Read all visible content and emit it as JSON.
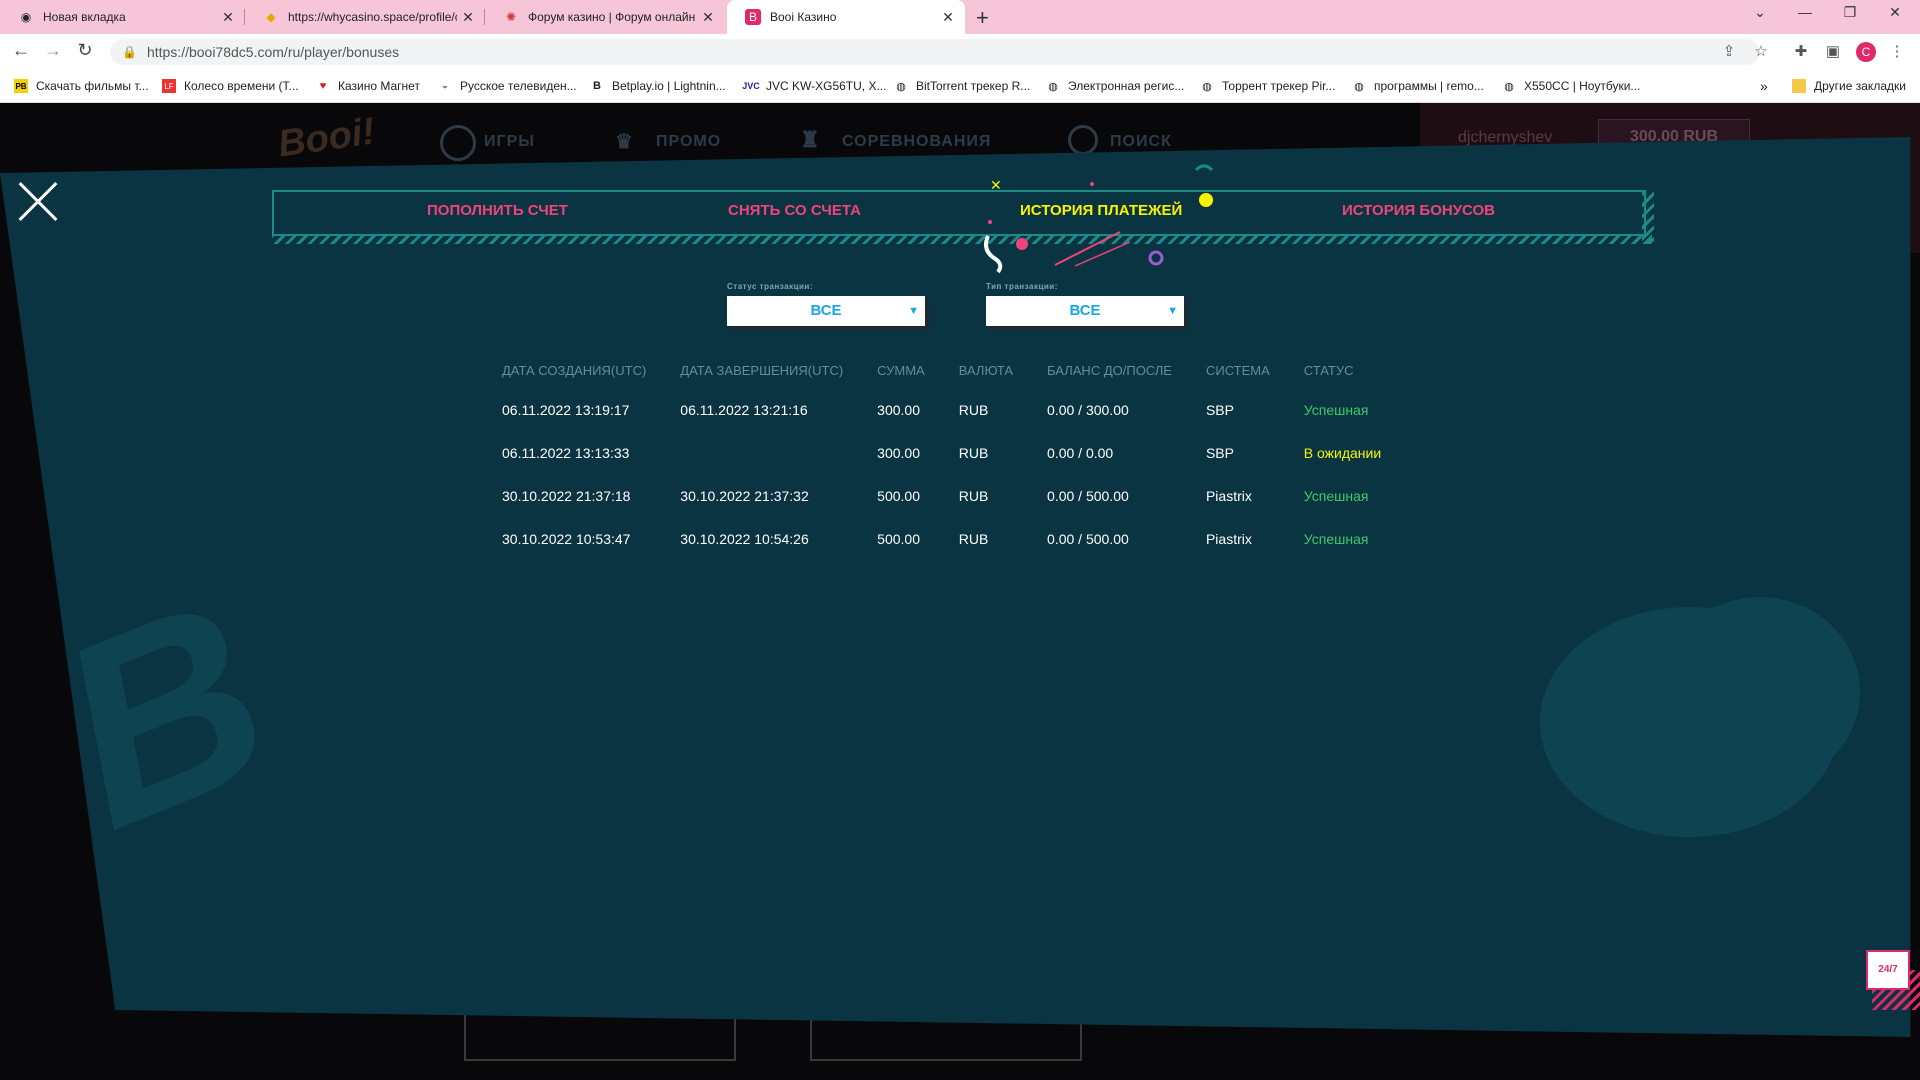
{
  "browser": {
    "tabs": [
      {
        "title": "Новая вкладка",
        "icon": "chrome-icon"
      },
      {
        "title": "https://whycasino.space/profile/c",
        "icon": "diamond-icon"
      },
      {
        "title": "Форум казино | Форум онлайн",
        "icon": "spinner-icon"
      },
      {
        "title": "Booi Казино",
        "icon": "booi-icon"
      }
    ],
    "url": "https://booi78dc5.com/ru/player/bonuses",
    "bookmarks": [
      "Скачать фильмы т...",
      "Колесо времени (T...",
      "Казино Магнет",
      "Русское телевиден...",
      "Betplay.io | Lightnin...",
      "JVC KW-XG56TU, X...",
      "BitTorrent трекер R...",
      "Электронная регис...",
      "Торрент трекер Pir...",
      "программы | remo...",
      "X550CC | Ноутбуки..."
    ],
    "bookmarks_more": "»",
    "other_bookmarks": "Другие закладки"
  },
  "site": {
    "nav": [
      "ИГРЫ",
      "ПРОМО",
      "СОРЕВНОВАНИЯ",
      "ПОИСК"
    ],
    "username": "djchernyshev",
    "balance": "300.00 RUB"
  },
  "modal": {
    "tabs": [
      "ПОПОЛНИТЬ СЧЕТ",
      "СНЯТЬ СО СЧЕТА",
      "ИСТОРИЯ ПЛАТЕЖЕЙ",
      "ИСТОРИЯ БОНУСОВ"
    ],
    "active_tab": "ИСТОРИЯ ПЛАТЕЖЕЙ",
    "filters": {
      "status_label": "Статус транзакции:",
      "status_value": "ВСЕ",
      "type_label": "Тип транзакции:",
      "type_value": "ВСЕ"
    },
    "table": {
      "headers": [
        "ДАТА СОЗДАНИЯ(UTC)",
        "ДАТА ЗАВЕРШЕНИЯ(UTC)",
        "СУММА",
        "ВАЛЮТА",
        "БАЛАНС ДО/ПОСЛЕ",
        "СИСТЕМА",
        "СТАТУС"
      ],
      "rows": [
        [
          "06.11.2022 13:19:17",
          "06.11.2022 13:21:16",
          "300.00",
          "RUB",
          "0.00 / 300.00",
          "SBP",
          "Успешная"
        ],
        [
          "06.11.2022 13:13:33",
          "",
          "300.00",
          "RUB",
          "0.00 / 0.00",
          "SBP",
          "В ожидании"
        ],
        [
          "30.10.2022 21:37:18",
          "30.10.2022 21:37:32",
          "500.00",
          "RUB",
          "0.00 / 500.00",
          "Piastrix",
          "Успешная"
        ],
        [
          "30.10.2022 10:53:47",
          "30.10.2022 10:54:26",
          "500.00",
          "RUB",
          "0.00 / 500.00",
          "Piastrix",
          "Успешная"
        ]
      ]
    },
    "support_label": "24/7"
  },
  "colors": {
    "modal_bg": "#0a3442",
    "tab_pink": "#f0437a",
    "tab_active": "#f8f400",
    "status_success": "#3ec96a",
    "status_pending": "#f8f400",
    "filter_text": "#19a7e2"
  }
}
